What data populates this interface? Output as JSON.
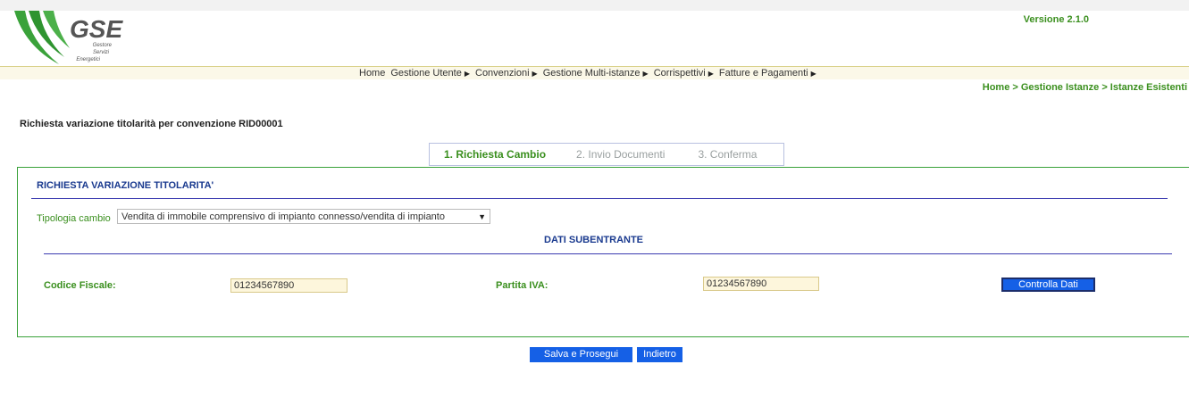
{
  "header": {
    "logo_text": "GSE",
    "logo_sub": [
      "Gestore",
      "Servizi",
      "Energetici"
    ],
    "version": "Versione 2.1.0"
  },
  "menu": [
    {
      "label": "Home",
      "has_arrow": false
    },
    {
      "label": "Gestione Utente",
      "has_arrow": true
    },
    {
      "label": "Convenzioni",
      "has_arrow": true
    },
    {
      "label": "Gestione Multi-istanze",
      "has_arrow": true
    },
    {
      "label": "Corrispettivi",
      "has_arrow": true
    },
    {
      "label": "Fatture e Pagamenti",
      "has_arrow": true
    }
  ],
  "breadcrumb": "Home > Gestione Istanze > Istanze Esistenti",
  "page_title": "Richiesta variazione titolarità per convenzione RID00001",
  "steps": [
    {
      "label": "1. Richiesta Cambio",
      "active": true
    },
    {
      "label": "2. Invio Documenti",
      "active": false
    },
    {
      "label": "3. Conferma",
      "active": false
    }
  ],
  "panel": {
    "title": "RICHIESTA VARIAZIONE TITOLARITA'",
    "tipologia_label": "Tipologia cambio",
    "tipologia_value": "Vendita di immobile comprensivo di impianto connesso/vendita di impianto",
    "section_title": "DATI SUBENTRANTE",
    "codice_fiscale_label": "Codice Fiscale:",
    "codice_fiscale_value": "01234567890",
    "partita_iva_label": "Partita IVA:",
    "partita_iva_value": "01234567890",
    "controlla_button": "Controlla Dati"
  },
  "actions": {
    "save_label": "Salva e Prosegui",
    "back_label": "Indietro"
  },
  "colors": {
    "brand_green": "#3a8f1e",
    "title_blue": "#1a3a8f",
    "button_blue": "#1560e6"
  }
}
